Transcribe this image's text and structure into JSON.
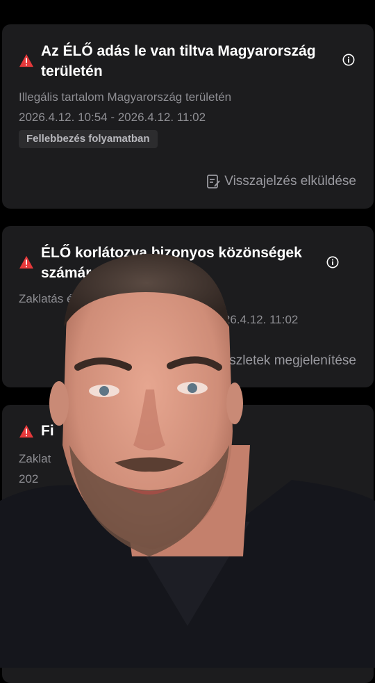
{
  "cards": [
    {
      "title": "Az ÉLŐ adás le van tiltva Magyarország területén",
      "reason": "Illegális tartalom Magyarország területén",
      "time": "2026.4.12. 10:54 - 2026.4.12. 11:02",
      "badge": "Fellebbezés folyamatban",
      "action": "Visszajelzés elküldése"
    },
    {
      "title": "ÉLŐ korlátozva bizonyos közönségek számára",
      "reason": "Zaklatás és",
      "time": "2026.4.12. 11:02",
      "action": "Részletek megjelenítése"
    },
    {
      "title": "Fi",
      "reason": "Zaklat",
      "time": "202"
    }
  ],
  "colors": {
    "warning": "#e5393b",
    "card_bg": "#1c1c1e",
    "muted_text": "#8e8e93"
  }
}
